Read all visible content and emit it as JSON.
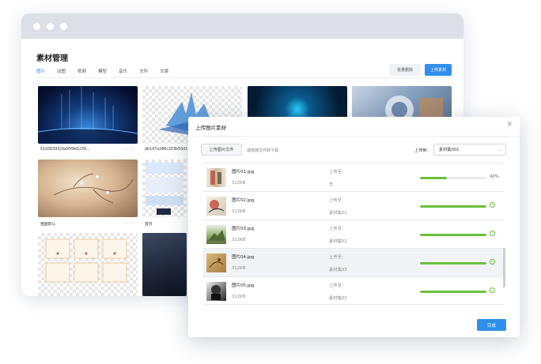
{
  "library": {
    "title": "素材管理",
    "tabs": [
      "图片",
      "动图",
      "视频",
      "模型",
      "音乐",
      "文件",
      "文章"
    ],
    "batch_delete": "批量删除",
    "upload": "上传素材",
    "cards": [
      {
        "caption": "51d363932fa00f9d1235..."
      },
      {
        "caption": "db147a286c203b50d1"
      },
      {
        "caption": ""
      },
      {
        "caption": ""
      },
      {
        "caption": "祖国默认"
      },
      {
        "caption": "首页"
      }
    ]
  },
  "modal": {
    "title": "上传图片素材",
    "upload_file_button": "上传图片文件",
    "drag_hint": "或拖拽文件到下载",
    "upload_to_label": "上传到：",
    "upload_to_value": "素材集001",
    "done_button": "完成",
    "files": [
      {
        "name": "图片01.jpg",
        "size": "312KB",
        "label": "上传至：",
        "dest": "无",
        "progress": 0.4,
        "pct": "40%"
      },
      {
        "name": "图片02.jpg",
        "size": "312KB",
        "label": "上传至：",
        "dest": "素材集01",
        "progress": 1.0,
        "pct": ""
      },
      {
        "name": "图片03.jpg",
        "size": "312KB",
        "label": "上传至：",
        "dest": "素材集02",
        "progress": 1.0,
        "pct": ""
      },
      {
        "name": "图片04.jpg",
        "size": "312KB",
        "label": "上传至：",
        "dest": "素材集03",
        "progress": 1.0,
        "pct": ""
      },
      {
        "name": "图片05.jpg",
        "size": "312KB",
        "label": "上传至：",
        "dest": "素材集01",
        "progress": 1.0,
        "pct": ""
      }
    ]
  },
  "colors": {
    "accent": "#2f8fea",
    "progress": "#6bbf3c"
  }
}
